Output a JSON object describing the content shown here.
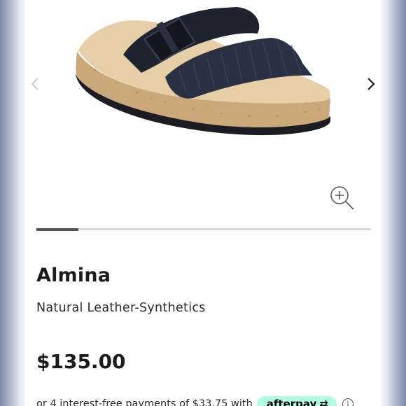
{
  "carousel": {
    "image_alt": "Almina sandal",
    "prev_icon": "chevron-left-icon",
    "next_icon": "chevron-right-icon",
    "zoom_icon": "zoom-in-icon",
    "progress_fraction": 0.125
  },
  "product": {
    "name": "Almina",
    "material": "Natural Leather-Synthetics",
    "price": "$135.00"
  },
  "payment": {
    "installment_text": "or 4 interest-free payments of $33.75 with",
    "provider_label": "afterpay",
    "provider_glyph": "⇄",
    "info_icon": "info-icon",
    "info_glyph": "i"
  },
  "colors": {
    "accent": "#b2fce4",
    "text": "#1c1c1c",
    "progress": "#555555"
  }
}
